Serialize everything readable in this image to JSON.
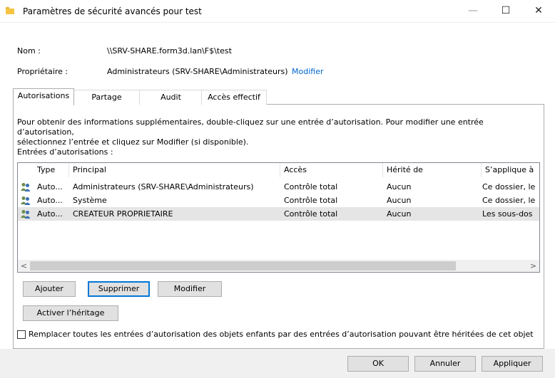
{
  "window": {
    "title": "Paramètres de sécurité avancés pour test",
    "minimize_glyph": "—",
    "maximize_glyph": "☐",
    "close_glyph": "✕"
  },
  "info": {
    "name_label": "Nom :",
    "name_value": "\\\\SRV-SHARE.form3d.lan\\F$\\test",
    "owner_label": "Propriétaire :",
    "owner_value": "Administrateurs (SRV-SHARE\\Administrateurs)",
    "owner_change_link": "Modifier"
  },
  "tabs": [
    {
      "label": "Autorisations",
      "active": true
    },
    {
      "label": "Partage",
      "active": false
    },
    {
      "label": "Audit",
      "active": false
    },
    {
      "label": "Accès effectif",
      "active": false
    }
  ],
  "permissions": {
    "description_line1": "Pour obtenir des informations supplémentaires, double-cliquez sur une entrée d’autorisation. Pour modifier une entrée d’autorisation,",
    "description_line2": "sélectionnez l’entrée et cliquez sur Modifier (si disponible).",
    "entries_label": "Entrées d’autorisations :",
    "columns": [
      "Type",
      "Principal",
      "Accès",
      "Hérité de",
      "S’applique à"
    ],
    "rows": [
      {
        "icon": "users-icon",
        "type": "Auto...",
        "principal": "Administrateurs (SRV-SHARE\\Administrateurs)",
        "access": "Contrôle total",
        "inherited": "Aucun",
        "applies": "Ce dossier, le",
        "selected": false
      },
      {
        "icon": "users-icon",
        "type": "Auto...",
        "principal": "Système",
        "access": "Contrôle total",
        "inherited": "Aucun",
        "applies": "Ce dossier, le",
        "selected": false
      },
      {
        "icon": "users-icon",
        "type": "Auto...",
        "principal": "CREATEUR PROPRIETAIRE",
        "access": "Contrôle total",
        "inherited": "Aucun",
        "applies": "Les sous-dos",
        "selected": true
      }
    ],
    "scroll_left": "<",
    "scroll_right": ">"
  },
  "buttons": {
    "add": "Ajouter",
    "remove": "Supprimer",
    "edit": "Modifier",
    "enable_inheritance": "Activer l’héritage"
  },
  "replace_checkbox": {
    "label": "Remplacer toutes les entrées d’autorisation des objets enfants par des entrées d’autorisation pouvant être héritées de cet objet",
    "checked": false
  },
  "footer": {
    "ok": "OK",
    "cancel": "Annuler",
    "apply": "Appliquer"
  },
  "colors": {
    "accent": "#0078d7",
    "link": "#0066cc",
    "selection": "#e5e5e5"
  }
}
